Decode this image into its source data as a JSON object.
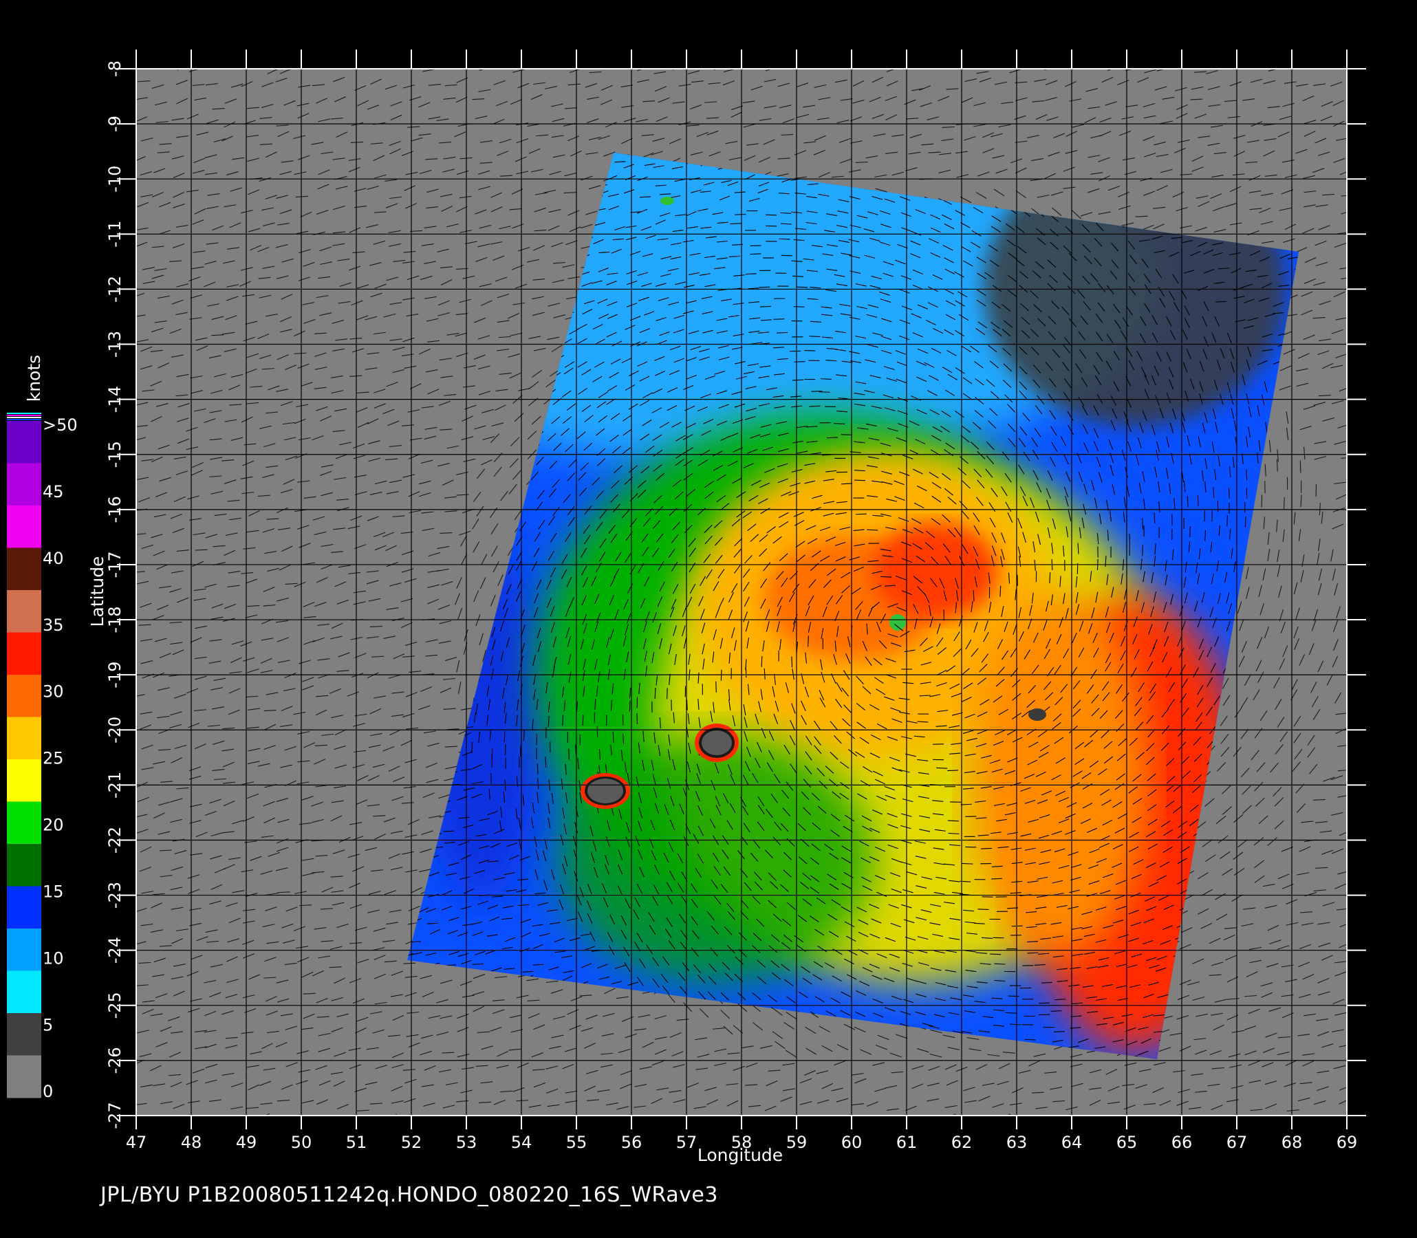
{
  "map": {
    "x_axis": {
      "label": "Longitude",
      "ticks": [
        "47",
        "48",
        "49",
        "50",
        "51",
        "52",
        "53",
        "54",
        "55",
        "56",
        "57",
        "58",
        "59",
        "60",
        "61",
        "62",
        "63",
        "64",
        "65",
        "66",
        "67",
        "68",
        "69"
      ]
    },
    "y_axis": {
      "label": "Latitude",
      "ticks": [
        "-8",
        "-9",
        "-10",
        "-11",
        "-12",
        "-13",
        "-14",
        "-15",
        "-16",
        "-17",
        "-18",
        "-19",
        "-20",
        "-21",
        "-22",
        "-23",
        "-24",
        "-25",
        "-26",
        "-27"
      ]
    },
    "background_color": "#808080",
    "features": [
      "wind speed swath",
      "wind vectors",
      "cyclone center",
      "islands"
    ]
  },
  "colorbar": {
    "unit": "knots",
    "labels": [
      ">50",
      "45",
      "40",
      "35",
      "30",
      "25",
      "20",
      "15",
      "10",
      "5",
      "0"
    ],
    "colors": [
      "#6a00c8",
      "#b000e0",
      "#f000f0",
      "#5a1a0a",
      "#d07050",
      "#ff1a00",
      "#ff6a00",
      "#ffc800",
      "#ffff00",
      "#00e000",
      "#007000",
      "#0030ff",
      "#00a0ff",
      "#00e8ff",
      "#404040",
      "#808080"
    ]
  },
  "footer": {
    "text": "JPL/BYU  P1B20080511242q.HONDO_080220_16S_WRave3"
  }
}
